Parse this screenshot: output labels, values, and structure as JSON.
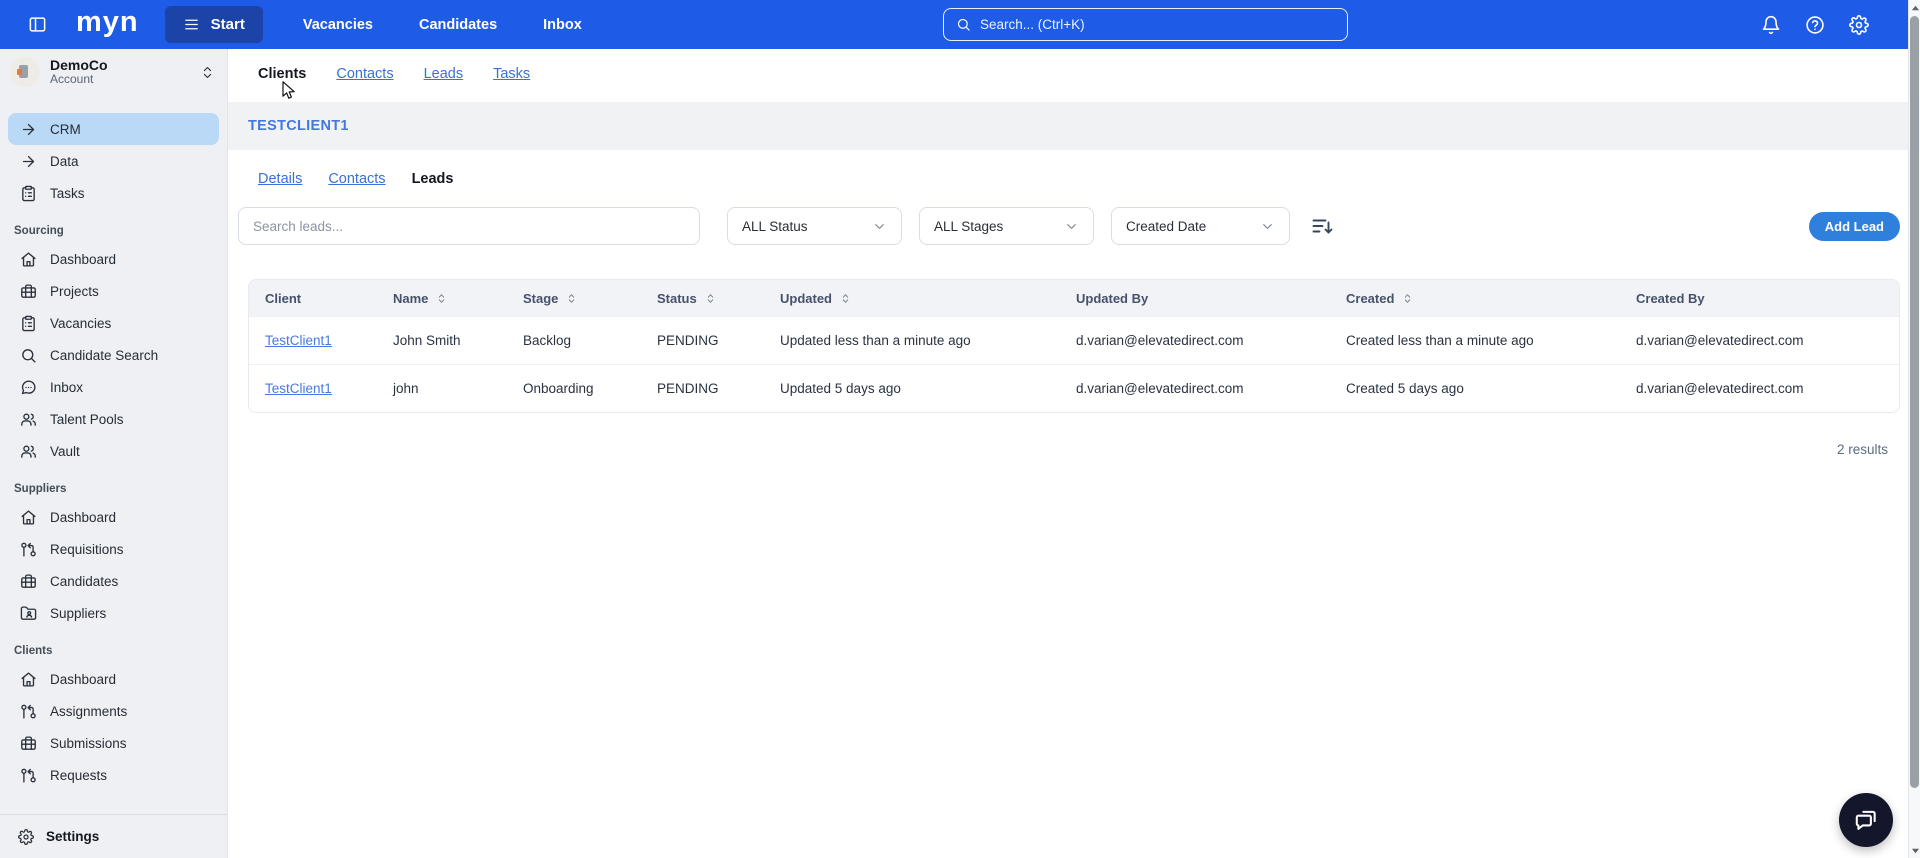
{
  "colors": {
    "nav_blue": "#1e5ce8",
    "start_button_blue": "#1c43a8",
    "active_item_blue": "#b9d9f7",
    "link_blue": "#3b6fd9",
    "add_button_blue": "#2f80dd"
  },
  "topbar": {
    "logo": "myn",
    "start_label": "Start",
    "nav": [
      {
        "id": "vacancies",
        "label": "Vacancies"
      },
      {
        "id": "candidates",
        "label": "Candidates"
      },
      {
        "id": "inbox",
        "label": "Inbox"
      }
    ],
    "search_placeholder": "Search... (Ctrl+K)"
  },
  "sidebar": {
    "account": {
      "name": "DemoCo",
      "type": "Account"
    },
    "primary": [
      {
        "id": "crm",
        "label": "CRM",
        "icon": "arrow-right",
        "active": true
      },
      {
        "id": "data",
        "label": "Data",
        "icon": "arrow-right",
        "active": false
      },
      {
        "id": "tasks",
        "label": "Tasks",
        "icon": "clipboard",
        "active": false
      }
    ],
    "sections": [
      {
        "title": "Sourcing",
        "items": [
          {
            "id": "sourcing-dashboard",
            "label": "Dashboard",
            "icon": "home"
          },
          {
            "id": "projects",
            "label": "Projects",
            "icon": "briefcase"
          },
          {
            "id": "vacancies",
            "label": "Vacancies",
            "icon": "clipboard"
          },
          {
            "id": "candidate-search",
            "label": "Candidate Search",
            "icon": "magnifier"
          },
          {
            "id": "inbox",
            "label": "Inbox",
            "icon": "chat"
          },
          {
            "id": "talent-pools",
            "label": "Talent Pools",
            "icon": "users"
          },
          {
            "id": "vault",
            "label": "Vault",
            "icon": "users"
          }
        ]
      },
      {
        "title": "Suppliers",
        "items": [
          {
            "id": "suppliers-dashboard",
            "label": "Dashboard",
            "icon": "home"
          },
          {
            "id": "requisitions",
            "label": "Requisitions",
            "icon": "branch"
          },
          {
            "id": "candidates",
            "label": "Candidates",
            "icon": "briefcase"
          },
          {
            "id": "suppliers",
            "label": "Suppliers",
            "icon": "folder-user"
          }
        ]
      },
      {
        "title": "Clients",
        "items": [
          {
            "id": "clients-dashboard",
            "label": "Dashboard",
            "icon": "home"
          },
          {
            "id": "assignments",
            "label": "Assignments",
            "icon": "branch"
          },
          {
            "id": "submissions",
            "label": "Submissions",
            "icon": "briefcase"
          },
          {
            "id": "requests",
            "label": "Requests",
            "icon": "branch"
          }
        ]
      }
    ],
    "settings_label": "Settings"
  },
  "page": {
    "tabs": [
      {
        "id": "clients",
        "label": "Clients",
        "active": true
      },
      {
        "id": "contacts",
        "label": "Contacts",
        "active": false
      },
      {
        "id": "leads",
        "label": "Leads",
        "active": false
      },
      {
        "id": "tasks",
        "label": "Tasks",
        "active": false
      }
    ],
    "client_title": "TESTCLIENT1",
    "subtabs": [
      {
        "id": "details",
        "label": "Details",
        "active": false
      },
      {
        "id": "contacts",
        "label": "Contacts",
        "active": false
      },
      {
        "id": "leads",
        "label": "Leads",
        "active": true
      }
    ],
    "filters": {
      "search_placeholder": "Search leads...",
      "status_value": "ALL Status",
      "stage_value": "ALL Stages",
      "sort_value": "Created Date"
    },
    "add_lead_label": "Add Lead",
    "results_count": "2 results"
  },
  "table": {
    "columns": [
      {
        "key": "client",
        "label": "Client",
        "sortable": false
      },
      {
        "key": "name",
        "label": "Name",
        "sortable": true
      },
      {
        "key": "stage",
        "label": "Stage",
        "sortable": true
      },
      {
        "key": "status",
        "label": "Status",
        "sortable": true
      },
      {
        "key": "updated",
        "label": "Updated",
        "sortable": true
      },
      {
        "key": "updated_by",
        "label": "Updated By",
        "sortable": false
      },
      {
        "key": "created",
        "label": "Created",
        "sortable": true
      },
      {
        "key": "created_by",
        "label": "Created By",
        "sortable": false
      }
    ],
    "rows": [
      {
        "client": "TestClient1",
        "name": "John Smith",
        "stage": "Backlog",
        "status": "PENDING",
        "updated": "Updated less than a minute ago",
        "updated_by": "d.varian@elevatedirect.com",
        "created": "Created less than a minute ago",
        "created_by": "d.varian@elevatedirect.com"
      },
      {
        "client": "TestClient1",
        "name": "john",
        "stage": "Onboarding",
        "status": "PENDING",
        "updated": "Updated 5 days ago",
        "updated_by": "d.varian@elevatedirect.com",
        "created": "Created 5 days ago",
        "created_by": "d.varian@elevatedirect.com"
      }
    ]
  }
}
